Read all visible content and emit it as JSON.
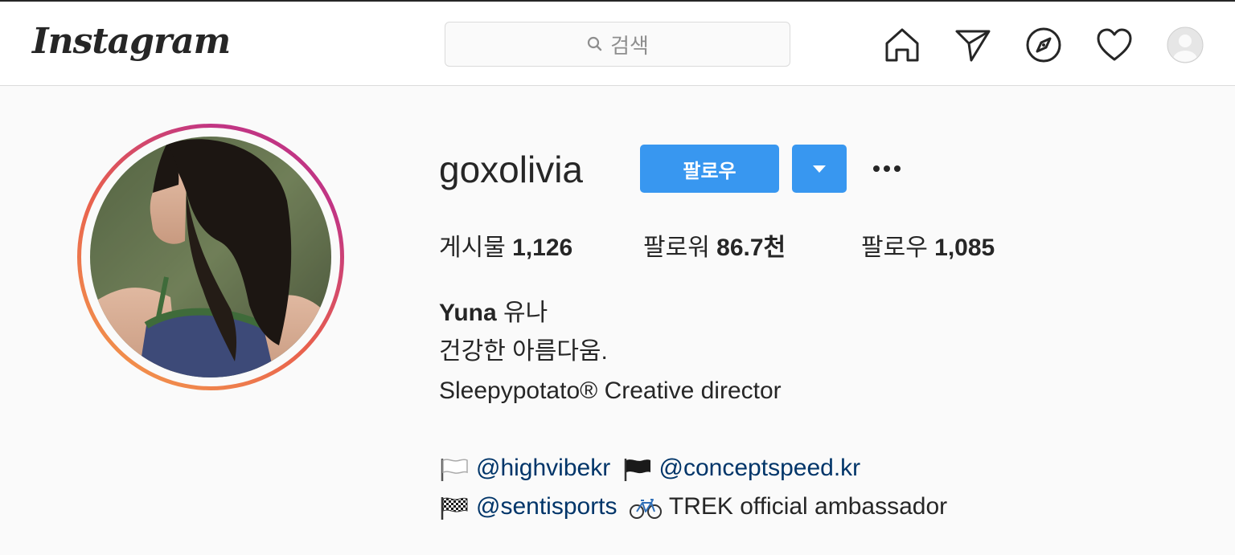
{
  "header": {
    "logo": "Instagram",
    "search_placeholder": "검색"
  },
  "profile": {
    "username": "goxolivia",
    "follow_label": "팔로우",
    "stats": {
      "posts_label": "게시물",
      "posts_value": "1,126",
      "followers_label": "팔로워",
      "followers_value": "86.7천",
      "following_label": "팔로우",
      "following_value": "1,085"
    },
    "bio": {
      "name": "Yuna",
      "name_suffix": "유나",
      "line1": "건강한 아름다움.",
      "line2": "Sleepypotato® Creative director",
      "mention1": "@highvibekr",
      "mention2": "@conceptspeed.kr",
      "mention3": "@sentisports",
      "tail": "TREK official ambassador"
    }
  },
  "icons": {
    "home": "home-icon",
    "direct": "paper-plane-icon",
    "explore": "compass-icon",
    "activity": "heart-icon",
    "profile": "avatar-icon",
    "search": "search-icon"
  },
  "colors": {
    "accent": "#3897f0",
    "link": "#003569",
    "ring_start": "#f5a14a",
    "ring_end": "#c13584"
  }
}
